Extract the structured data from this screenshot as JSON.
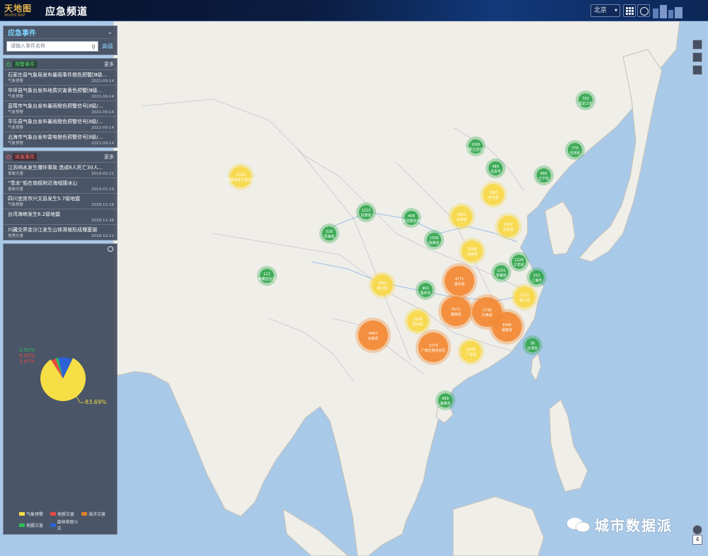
{
  "header": {
    "logo_main": "天地图",
    "logo_sub": "WUZHI MAP",
    "title": "应急频道",
    "city": "北京"
  },
  "search": {
    "title": "应急事件",
    "placeholder": "请输入事件名称",
    "advanced": "高级"
  },
  "warnings": {
    "label": "预警事件",
    "more": "更多",
    "items": [
      {
        "title": "石家庄县气象局发布暴雨事件橙色预警[Ⅲ级...",
        "type": "气象预警",
        "date": "2021-09-14"
      },
      {
        "title": "华坪县气象台发布地质灾害黄色预警[Ⅲ级...",
        "type": "气象预警",
        "date": "2021-09-14"
      },
      {
        "title": "蓝莓市气象台发布暴雨橙色预警信号[Ⅱ级/...",
        "type": "气象预警",
        "date": "2021-09-14"
      },
      {
        "title": "平乐县气象台发布暴雨橙色预警信号[Ⅱ级/...",
        "type": "气象预警",
        "date": "2021-09-14"
      },
      {
        "title": "北海市气象台发布雷电橙色预警信号[Ⅱ级/...",
        "type": "气象预警",
        "date": "2021-09-14"
      }
    ]
  },
  "emergencies": {
    "label": "突发事件",
    "more": "更多",
    "items": [
      {
        "title": "江苏响水发生爆炸事故 造成6人死亡30人...",
        "type": "事故灾害",
        "date": "2019-03-21"
      },
      {
        "title": "“雪龙”船在南极附近海域撞冰山",
        "type": "事故灾害",
        "date": "2019-01-19"
      },
      {
        "title": "四川宜宾市兴文县发生5.7级地震",
        "type": "气象预警",
        "date": "2018-12-16"
      },
      {
        "title": "台湾海峡发生6.2级地震",
        "type": "",
        "date": "2018-11-26"
      },
      {
        "title": "川藏交界金沙江发生山体滑坡形成堰塞湖",
        "type": "地质灾害",
        "date": "2018-10-11"
      }
    ]
  },
  "pie": {
    "main_pct": "83.69%",
    "labels": [
      "2.02%",
      "0.02%",
      "3.47%"
    ],
    "fractions": [
      0.8369,
      0.0347,
      0.0002,
      0.0202,
      0.108
    ],
    "colors": [
      "#f6de46",
      "#e84a44",
      "#e07f2c",
      "#2fbf55",
      "#2d62d6"
    ],
    "legend": [
      {
        "label": "气象预警",
        "color": "#f6de46"
      },
      {
        "label": "地质灾害",
        "color": "#e84a44"
      },
      {
        "label": "海洋灾害",
        "color": "#e07f2c"
      },
      {
        "label": "地震灾害",
        "color": "#2fbf55"
      },
      {
        "label": "森林草原火灾",
        "color": "#2d62d6"
      }
    ]
  },
  "clusters": [
    {
      "count": "2785",
      "name": "新疆维吾尔自治区",
      "level": "yellow"
    },
    {
      "count": "750",
      "name": "黑龙江省",
      "level": "green"
    },
    {
      "count": "1695",
      "name": "内蒙古自治区",
      "level": "green"
    },
    {
      "count": "770",
      "name": "吉林省",
      "level": "green"
    },
    {
      "count": "895",
      "name": "辽宁省",
      "level": "green"
    },
    {
      "count": "480",
      "name": "北京市",
      "level": "green"
    },
    {
      "count": "1907",
      "name": "河北省",
      "level": "yellow"
    },
    {
      "count": "1213",
      "name": "甘肃省",
      "level": "green"
    },
    {
      "count": "408",
      "name": "宁夏回族自治区",
      "level": "green"
    },
    {
      "count": "1891",
      "name": "山西省",
      "level": "yellow"
    },
    {
      "count": "2007",
      "name": "山东省",
      "level": "yellow"
    },
    {
      "count": "528",
      "name": "青海省",
      "level": "green"
    },
    {
      "count": "1356",
      "name": "陕西省",
      "level": "green"
    },
    {
      "count": "2048",
      "name": "河南省",
      "level": "yellow"
    },
    {
      "count": "1229",
      "name": "江苏省",
      "level": "green"
    },
    {
      "count": "112",
      "name": "西藏自治区",
      "level": "green"
    },
    {
      "count": "1251",
      "name": "安徽省",
      "level": "green"
    },
    {
      "count": "252",
      "name": "上海市",
      "level": "green"
    },
    {
      "count": "4771",
      "name": "湖北省",
      "level": "orange"
    },
    {
      "count": "1945",
      "name": "四川省",
      "level": "yellow"
    },
    {
      "count": "901",
      "name": "重庆市",
      "level": "green"
    },
    {
      "count": "2212",
      "name": "浙江省",
      "level": "yellow"
    },
    {
      "count": "5571",
      "name": "湖南省",
      "level": "orange"
    },
    {
      "count": "2736",
      "name": "江西省",
      "level": "orange"
    },
    {
      "count": "2609",
      "name": "贵州省",
      "level": "yellow"
    },
    {
      "count": "4998",
      "name": "福建省",
      "level": "orange"
    },
    {
      "count": "4467",
      "name": "云南省",
      "level": "orange"
    },
    {
      "count": "3774",
      "name": "广西壮族自治区",
      "level": "orange"
    },
    {
      "count": "2078",
      "name": "广东省",
      "level": "yellow"
    },
    {
      "count": "38",
      "name": "台湾省",
      "level": "green"
    },
    {
      "count": "989",
      "name": "海南省",
      "level": "green"
    }
  ],
  "zoom": "4",
  "watermark": "城市数据派",
  "colors": {
    "green": "#36a851",
    "yellow": "#f8d94a",
    "orange": "#f38a35"
  }
}
